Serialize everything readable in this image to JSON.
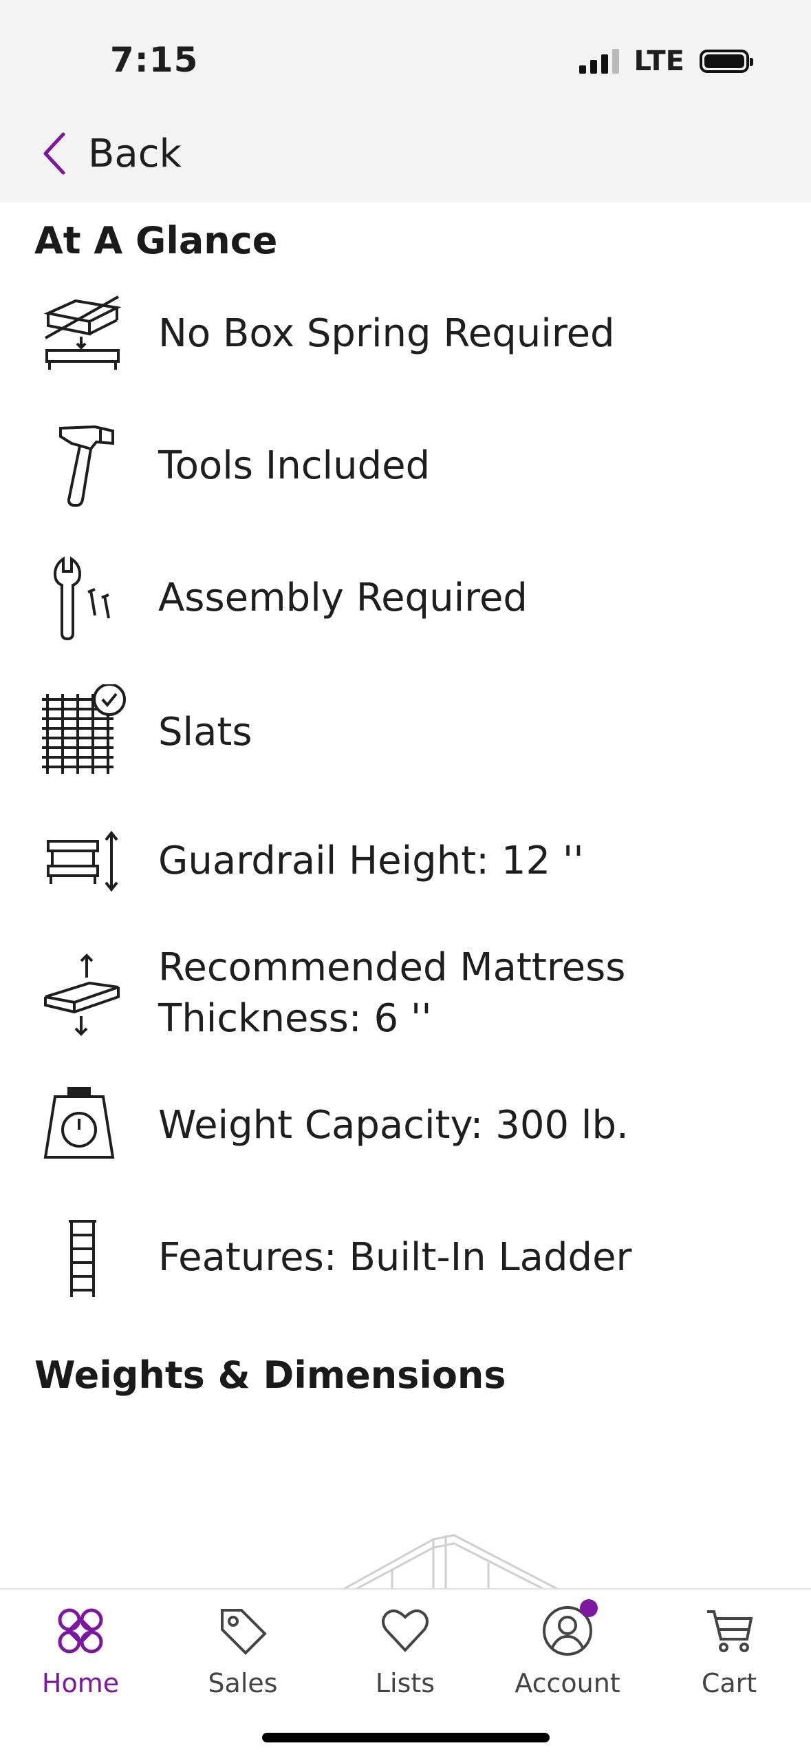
{
  "status_bar": {
    "time": "7:15",
    "network": "LTE"
  },
  "nav": {
    "back_label": "Back",
    "accent": "#7b189f"
  },
  "at_a_glance": {
    "title": "At A Glance",
    "items": [
      {
        "icon": "no-box-spring-icon",
        "text": "No Box Spring Required"
      },
      {
        "icon": "hammer-icon",
        "text": "Tools Included"
      },
      {
        "icon": "wrench-screws-icon",
        "text": "Assembly Required"
      },
      {
        "icon": "slats-icon",
        "text": "Slats"
      },
      {
        "icon": "guardrail-height-icon",
        "text": "Guardrail Height: 12 ''"
      },
      {
        "icon": "mattress-thickness-icon",
        "text": "Recommended Mattress Thickness: 6 ''"
      },
      {
        "icon": "scale-icon",
        "text": "Weight Capacity: 300 lb."
      },
      {
        "icon": "ladder-icon",
        "text": "Features: Built-In Ladder"
      }
    ]
  },
  "weights_dimensions": {
    "title": "Weights & Dimensions"
  },
  "tab_bar": {
    "active": "Home",
    "tabs": [
      {
        "icon": "home-icon",
        "label": "Home"
      },
      {
        "icon": "sales-tag-icon",
        "label": "Sales"
      },
      {
        "icon": "heart-icon",
        "label": "Lists"
      },
      {
        "icon": "account-icon",
        "label": "Account",
        "badge": true
      },
      {
        "icon": "cart-icon",
        "label": "Cart"
      }
    ]
  }
}
